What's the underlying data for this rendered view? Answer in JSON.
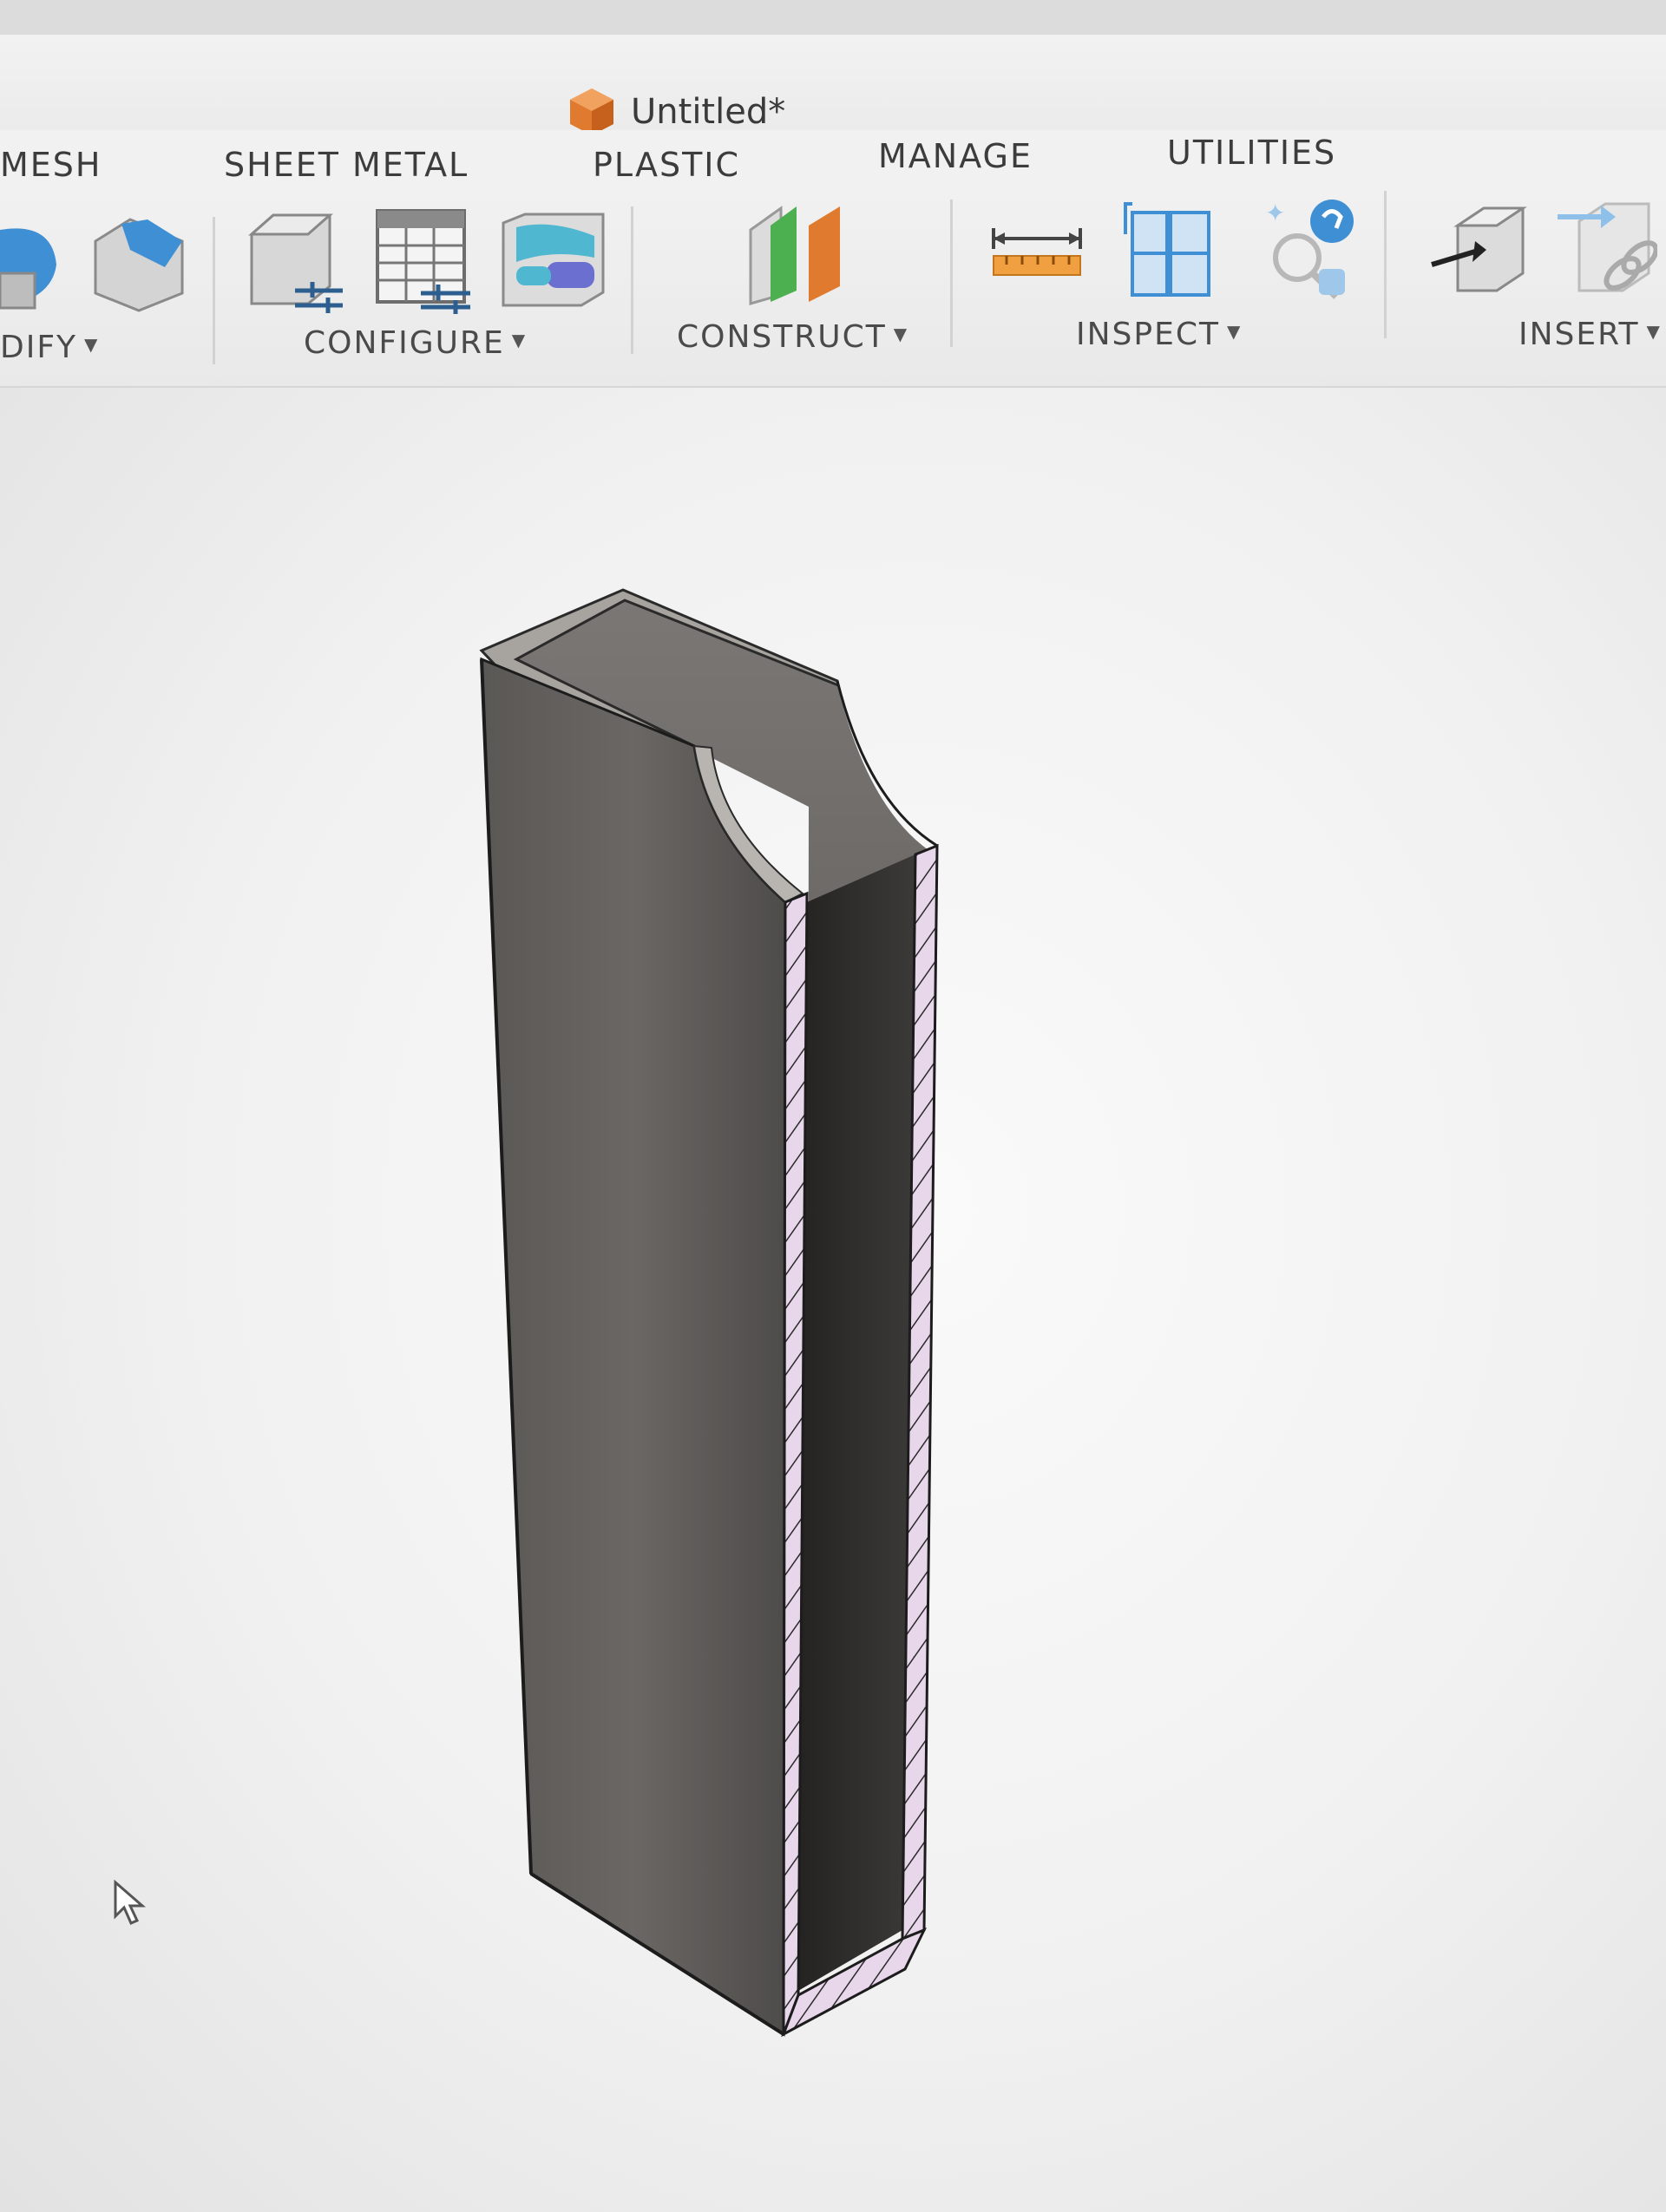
{
  "window": {
    "title": "Untitled*"
  },
  "tabs": [
    "MESH",
    "SHEET METAL",
    "PLASTIC",
    "MANAGE",
    "UTILITIES"
  ],
  "ribbon": {
    "groups": {
      "modify": "DIFY",
      "configure": "CONFIGURE",
      "construct": "CONSTRUCT",
      "inspect": "INSPECT",
      "insert": "INSERT"
    },
    "icons": {
      "modify": [
        "press-pull-icon",
        "fillet-icon"
      ],
      "configure": [
        "configure-parameters-icon",
        "configuration-table-icon",
        "theme-icon"
      ],
      "construct": [
        "offset-plane-icon"
      ],
      "inspect": [
        "measure-icon",
        "section-analysis-icon",
        "interference-icon"
      ],
      "insert": [
        "insert-derive-icon",
        "insert-link-icon"
      ]
    }
  },
  "colors": {
    "accent_orange": "#e07a2e",
    "accent_blue": "#3f8fd4",
    "model_body": "#5c5a58",
    "section_fill": "#e8d6ea"
  }
}
